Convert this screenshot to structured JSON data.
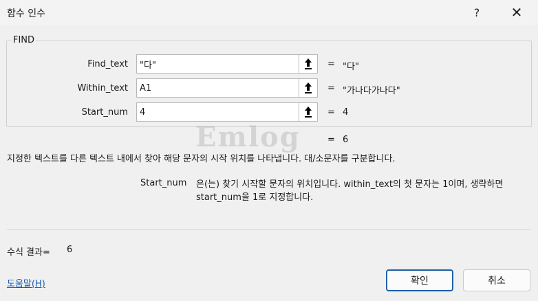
{
  "window": {
    "title": "함수 인수",
    "help_glyph": "?",
    "close_glyph": "✕"
  },
  "group": {
    "label": "FIND"
  },
  "arguments": [
    {
      "label": "Find_text",
      "input": "\"다\"",
      "value": "\"다\""
    },
    {
      "label": "Within_text",
      "input": "A1",
      "value": "\"가나다가나다\""
    },
    {
      "label": "Start_num",
      "input": "4",
      "value": "4"
    }
  ],
  "equals_sign": "=",
  "result": {
    "value": "6"
  },
  "watermark": "Emlog",
  "description": "지정한 텍스트를 다른 텍스트 내에서 찾아 해당 문자의 시작 위치를 나타냅니다. 대/소문자를 구분합니다.",
  "arg_help": {
    "name": "Start_num",
    "text": "은(는) 찾기 시작할 문자의 위치입니다. within_text의 첫 문자는 1이며, 생략하면 start_num을 1로 지정합니다."
  },
  "formula_result": {
    "label": "수식 결과=",
    "value": "6"
  },
  "help_link": "도움말(H)",
  "buttons": {
    "ok": "확인",
    "cancel": "취소"
  },
  "icons": {
    "ref": "collapse-dialog-arrow-icon"
  }
}
